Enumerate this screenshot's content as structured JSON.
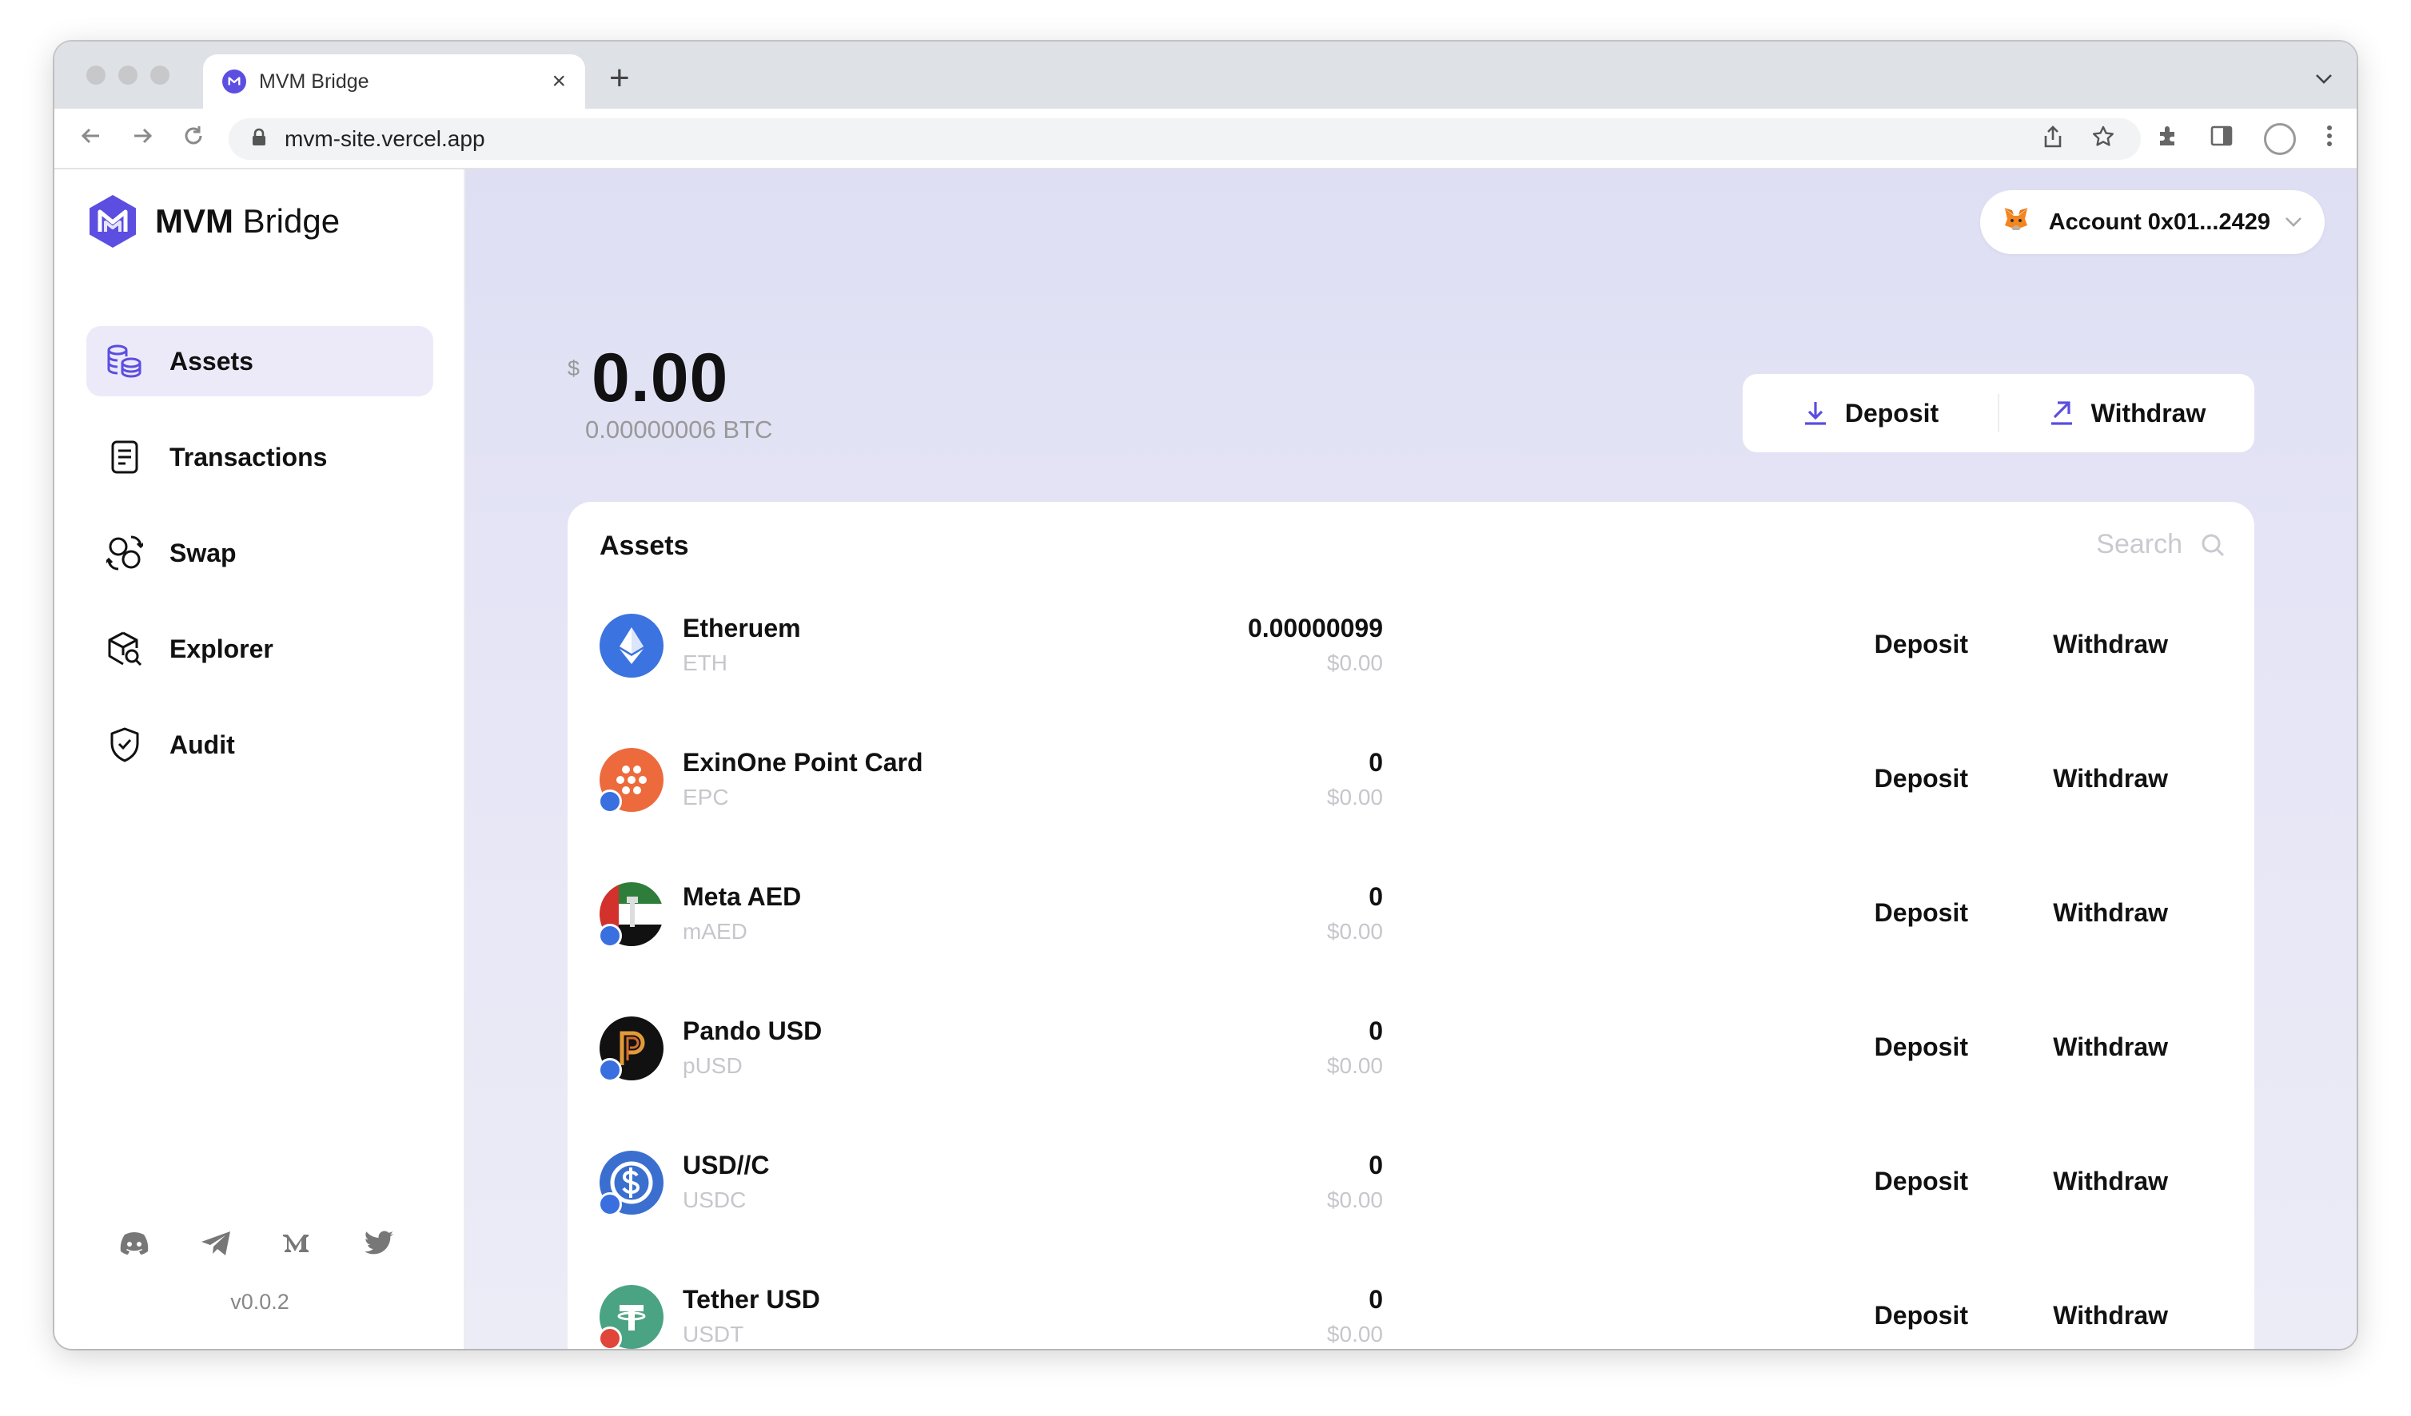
{
  "browser": {
    "tab_title": "MVM Bridge",
    "new_tab_glyph": "+",
    "close_glyph": "×",
    "url": "mvm-site.vercel.app"
  },
  "sidebar": {
    "logo_bold": "MVM",
    "logo_regular": "Bridge",
    "items": [
      {
        "label": "Assets",
        "icon": "coins-icon",
        "active": true
      },
      {
        "label": "Transactions",
        "icon": "receipt-icon",
        "active": false
      },
      {
        "label": "Swap",
        "icon": "swap-icon",
        "active": false
      },
      {
        "label": "Explorer",
        "icon": "explorer-icon",
        "active": false
      },
      {
        "label": "Audit",
        "icon": "shield-check-icon",
        "active": false
      }
    ],
    "socials": [
      "discord-icon",
      "telegram-icon",
      "medium-icon",
      "twitter-icon"
    ],
    "version": "v0.0.2"
  },
  "header": {
    "account_label": "Account 0x01...2429"
  },
  "balance": {
    "currency": "$",
    "amount": "0.00",
    "btc": "0.00000006 BTC"
  },
  "actions": {
    "deposit": "Deposit",
    "withdraw": "Withdraw"
  },
  "assets": {
    "title": "Assets",
    "search_placeholder": "Search",
    "rows": [
      {
        "name": "Etheruem",
        "symbol": "ETH",
        "amount": "0.00000099",
        "usd": "$0.00",
        "deposit": "Deposit",
        "withdraw": "Withdraw",
        "color": "#3b73e0"
      },
      {
        "name": "ExinOne Point Card",
        "symbol": "EPC",
        "amount": "0",
        "usd": "$0.00",
        "deposit": "Deposit",
        "withdraw": "Withdraw",
        "color": "#ec6a3c"
      },
      {
        "name": "Meta AED",
        "symbol": "mAED",
        "amount": "0",
        "usd": "$0.00",
        "deposit": "Deposit",
        "withdraw": "Withdraw",
        "color": "#2f7d3a"
      },
      {
        "name": "Pando USD",
        "symbol": "pUSD",
        "amount": "0",
        "usd": "$0.00",
        "deposit": "Deposit",
        "withdraw": "Withdraw",
        "color": "#111111"
      },
      {
        "name": "USD//C",
        "symbol": "USDC",
        "amount": "0",
        "usd": "$0.00",
        "deposit": "Deposit",
        "withdraw": "Withdraw",
        "color": "#3a6fcf"
      },
      {
        "name": "Tether USD",
        "symbol": "USDT",
        "amount": "0",
        "usd": "$0.00",
        "deposit": "Deposit",
        "withdraw": "Withdraw",
        "color": "#4aa483"
      }
    ]
  },
  "colors": {
    "accent": "#5b4ee0",
    "main_bg": "#e2e2f5",
    "muted_text": "#c6c6cc"
  }
}
